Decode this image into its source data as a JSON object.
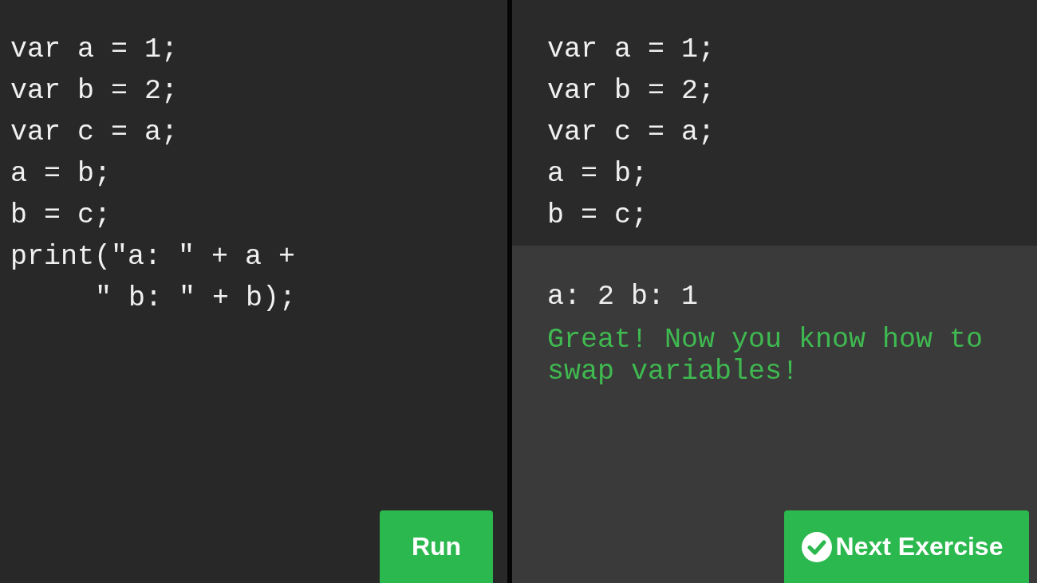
{
  "editor": {
    "lines": [
      {
        "kind": "line",
        "text": "var a = 1;"
      },
      {
        "kind": "line",
        "text": "var b = 2;"
      },
      {
        "kind": "line",
        "text": "var c = a;"
      },
      {
        "kind": "line",
        "text": "a = b;"
      },
      {
        "kind": "line",
        "text": "b = c;"
      },
      {
        "kind": "line",
        "text": "print(\"a: \" + a +"
      },
      {
        "kind": "continuation",
        "text": "\" b: \" + b);"
      }
    ],
    "run_button": "Run"
  },
  "result": {
    "code_lines": [
      {
        "kind": "line",
        "text": "var a = 1;"
      },
      {
        "kind": "line",
        "text": "var b = 2;"
      },
      {
        "kind": "line",
        "text": "var c = a;"
      },
      {
        "kind": "line",
        "text": "a = b;"
      },
      {
        "kind": "line",
        "text": "b = c;"
      }
    ],
    "output": "a: 2 b: 1",
    "message": "Great! Now you know how to swap variables!",
    "next_button": "Next Exercise"
  }
}
